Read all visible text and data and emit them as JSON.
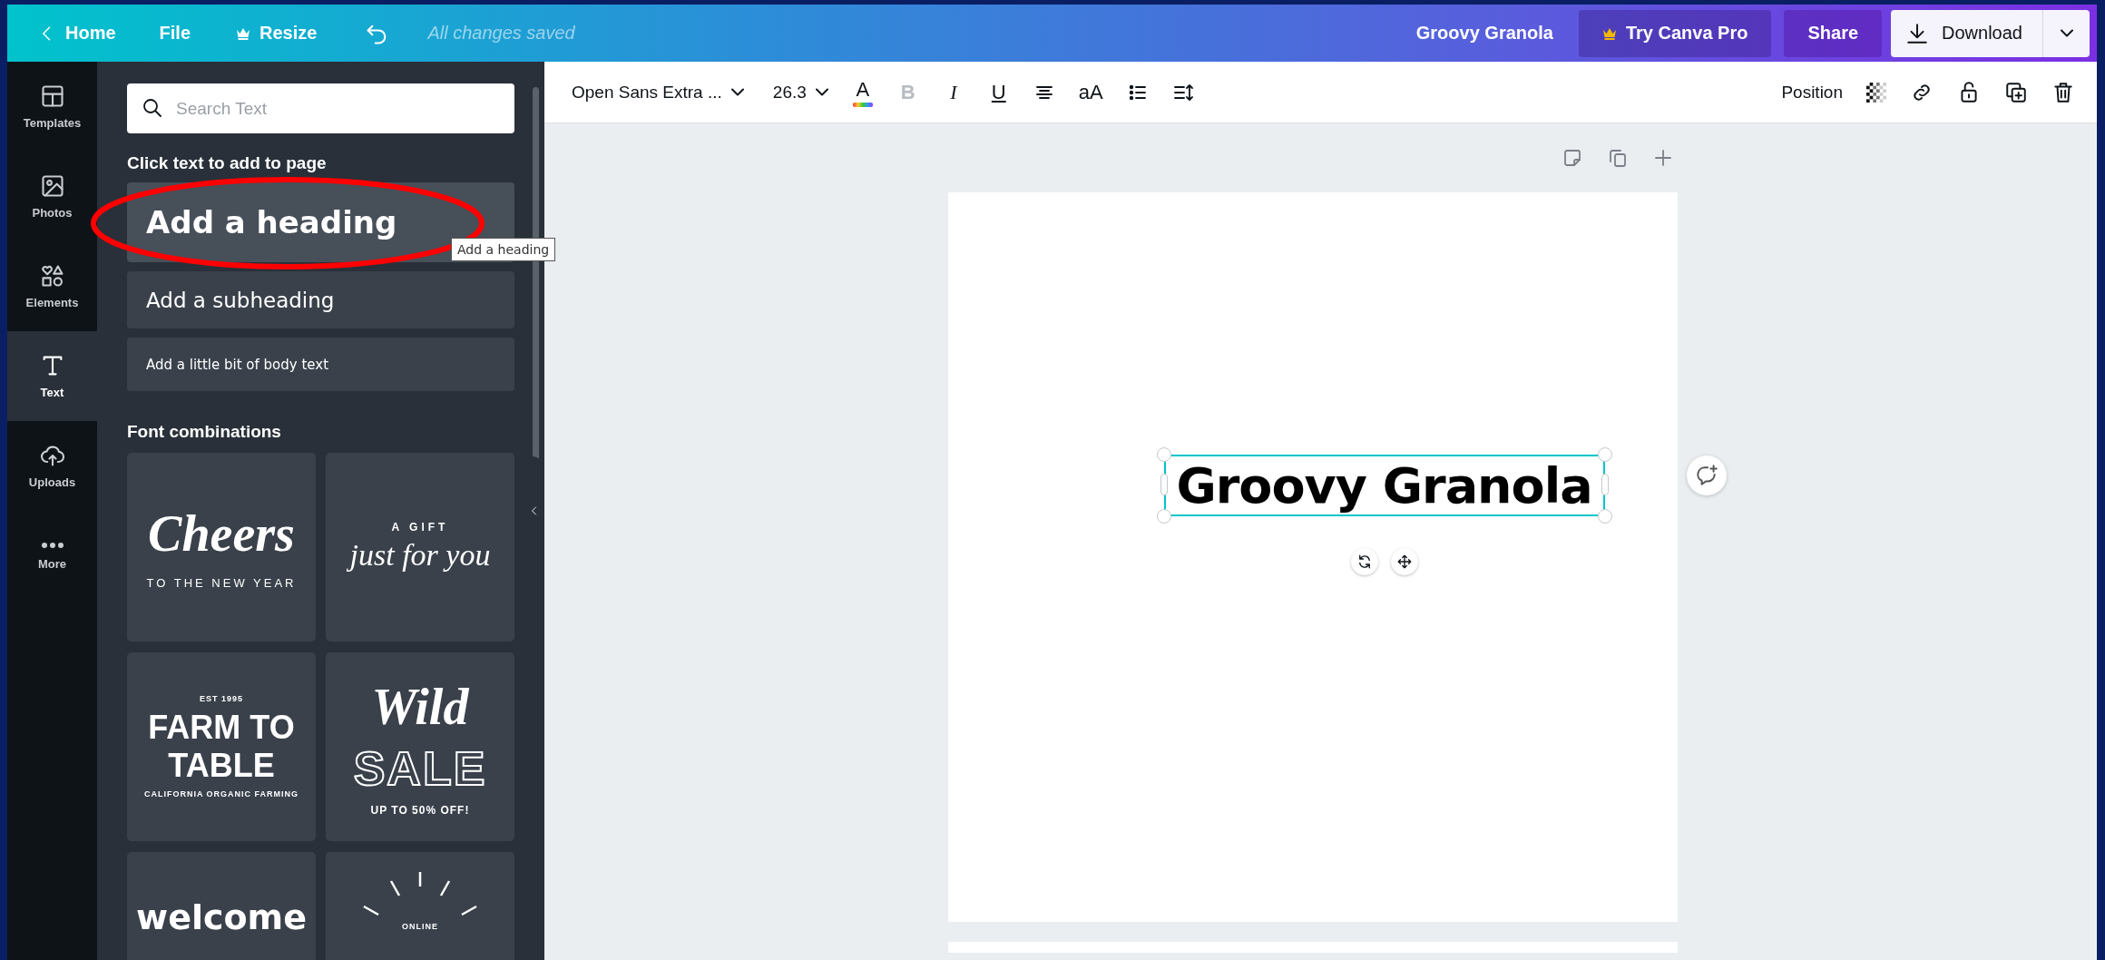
{
  "topbar": {
    "home": "Home",
    "file": "File",
    "resize": "Resize",
    "save_status": "All changes saved",
    "design_title": "Groovy Granola",
    "pro_button": "Try Canva Pro",
    "share_button": "Share",
    "download_button": "Download"
  },
  "rail": [
    {
      "label": "Templates",
      "selected": false
    },
    {
      "label": "Photos",
      "selected": false
    },
    {
      "label": "Elements",
      "selected": false
    },
    {
      "label": "Text",
      "selected": true
    },
    {
      "label": "Uploads",
      "selected": false
    },
    {
      "label": "More",
      "selected": false
    }
  ],
  "panel": {
    "search": {
      "placeholder": "Search Text"
    },
    "heading": "Click text to add to page",
    "text_styles": [
      {
        "kind": "heading",
        "label": "Add a heading"
      },
      {
        "kind": "subheading",
        "label": "Add a subheading"
      },
      {
        "kind": "body",
        "label": "Add a little bit of body text"
      }
    ],
    "tooltip": "Add a heading",
    "section_title": "Font combinations",
    "font_combinations": [
      {
        "kind": "plain",
        "lines": [
          {
            "text": "Cheers",
            "kind": "script-large"
          },
          {
            "text": "TO THE NEW YEAR",
            "kind": "spaced-caps"
          }
        ]
      },
      {
        "kind": "plain",
        "lines": [
          {
            "text": "A GIFT",
            "kind": "spaced-caps-bold"
          },
          {
            "text": "just for you",
            "kind": "script"
          }
        ]
      },
      {
        "kind": "plain",
        "lines": [
          {
            "text": "EST 1995",
            "kind": "tiny-caps"
          },
          {
            "text": "FARM TO TABLE",
            "kind": "block-caps"
          },
          {
            "text": "CALIFORNIA ORGANIC FARMING",
            "kind": "tiny-caps"
          }
        ]
      },
      {
        "kind": "plain",
        "lines": [
          {
            "text": "Wild",
            "kind": "script-large"
          },
          {
            "text": "SALE",
            "kind": "outline-caps"
          },
          {
            "text": "UP TO 50% OFF!",
            "kind": "small-bold-caps"
          }
        ]
      },
      {
        "kind": "plain",
        "lines": [
          {
            "text": "welcome",
            "kind": "brush"
          }
        ]
      },
      {
        "kind": "sunburst",
        "lines": [
          {
            "text": "ONLINE",
            "kind": "tiny-caps"
          }
        ]
      }
    ]
  },
  "toolbar": {
    "font": "Open Sans Extra ...",
    "size": "26.3",
    "color_button": "A",
    "format_buttons": [
      {
        "kind": "bold",
        "label": "B",
        "disabled": true
      },
      {
        "kind": "italic",
        "label": "I",
        "disabled": false
      },
      {
        "kind": "underline",
        "label": "U",
        "disabled": false
      }
    ],
    "case_button": "aA",
    "position_button": "Position"
  },
  "canvas": {
    "text_element": {
      "text": "Groovy Granola",
      "selected": true
    }
  }
}
